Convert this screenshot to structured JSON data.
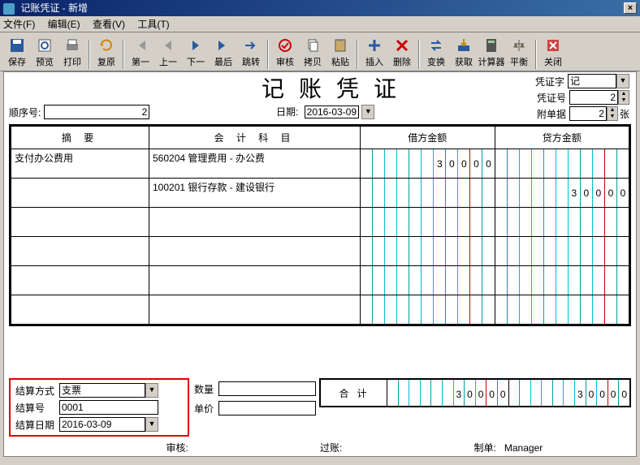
{
  "title": "记账凭证 - 新增",
  "menu": {
    "file": "文件(F)",
    "edit": "编辑(E)",
    "view": "查看(V)",
    "tool": "工具(T)"
  },
  "toolbar": {
    "save": "保存",
    "preview": "预览",
    "print": "打印",
    "restore": "复原",
    "first": "第一",
    "prev": "上一",
    "next": "下一",
    "last": "最后",
    "jump": "跳转",
    "audit": "审核",
    "copy": "拷贝",
    "paste": "粘贴",
    "insert": "插入",
    "delete": "删除",
    "convert": "变换",
    "fetch": "获取",
    "calc": "计算器",
    "balance": "平衡",
    "close": "关闭"
  },
  "doc_title": "记账凭证",
  "header": {
    "seq_label": "顺序号:",
    "seq_value": "2",
    "date_label": "日期:",
    "date_value": "2016-03-09",
    "voucher_word_label": "凭证字",
    "voucher_word_value": "记",
    "voucher_no_label": "凭证号",
    "voucher_no_value": "2",
    "attach_label": "附单据",
    "attach_value": "2",
    "attach_unit": "张"
  },
  "columns": {
    "summary": "摘 要",
    "subject": "会 计 科 目",
    "debit": "借方金额",
    "credit": "贷方金额"
  },
  "rows": [
    {
      "summary": "支付办公费用",
      "subject": "560204 管理费用 - 办公费",
      "debit": "30000",
      "credit": ""
    },
    {
      "summary": "",
      "subject": "100201 银行存款 - 建设银行",
      "debit": "",
      "credit": "30000"
    },
    {
      "summary": "",
      "subject": "",
      "debit": "",
      "credit": ""
    },
    {
      "summary": "",
      "subject": "",
      "debit": "",
      "credit": ""
    },
    {
      "summary": "",
      "subject": "",
      "debit": "",
      "credit": ""
    },
    {
      "summary": "",
      "subject": "",
      "debit": "",
      "credit": ""
    }
  ],
  "settle": {
    "method_label": "结算方式",
    "method_value": "支票",
    "no_label": "结算号",
    "no_value": "0001",
    "date_label": "结算日期",
    "date_value": "2016-03-09"
  },
  "qty": {
    "qty_label": "数量",
    "price_label": "单价"
  },
  "total": {
    "label": "合计",
    "debit": "30000",
    "credit": "30000"
  },
  "status": {
    "audit_label": "审核:",
    "post_label": "过账:",
    "maker_label": "制单:",
    "maker_value": "Manager"
  }
}
